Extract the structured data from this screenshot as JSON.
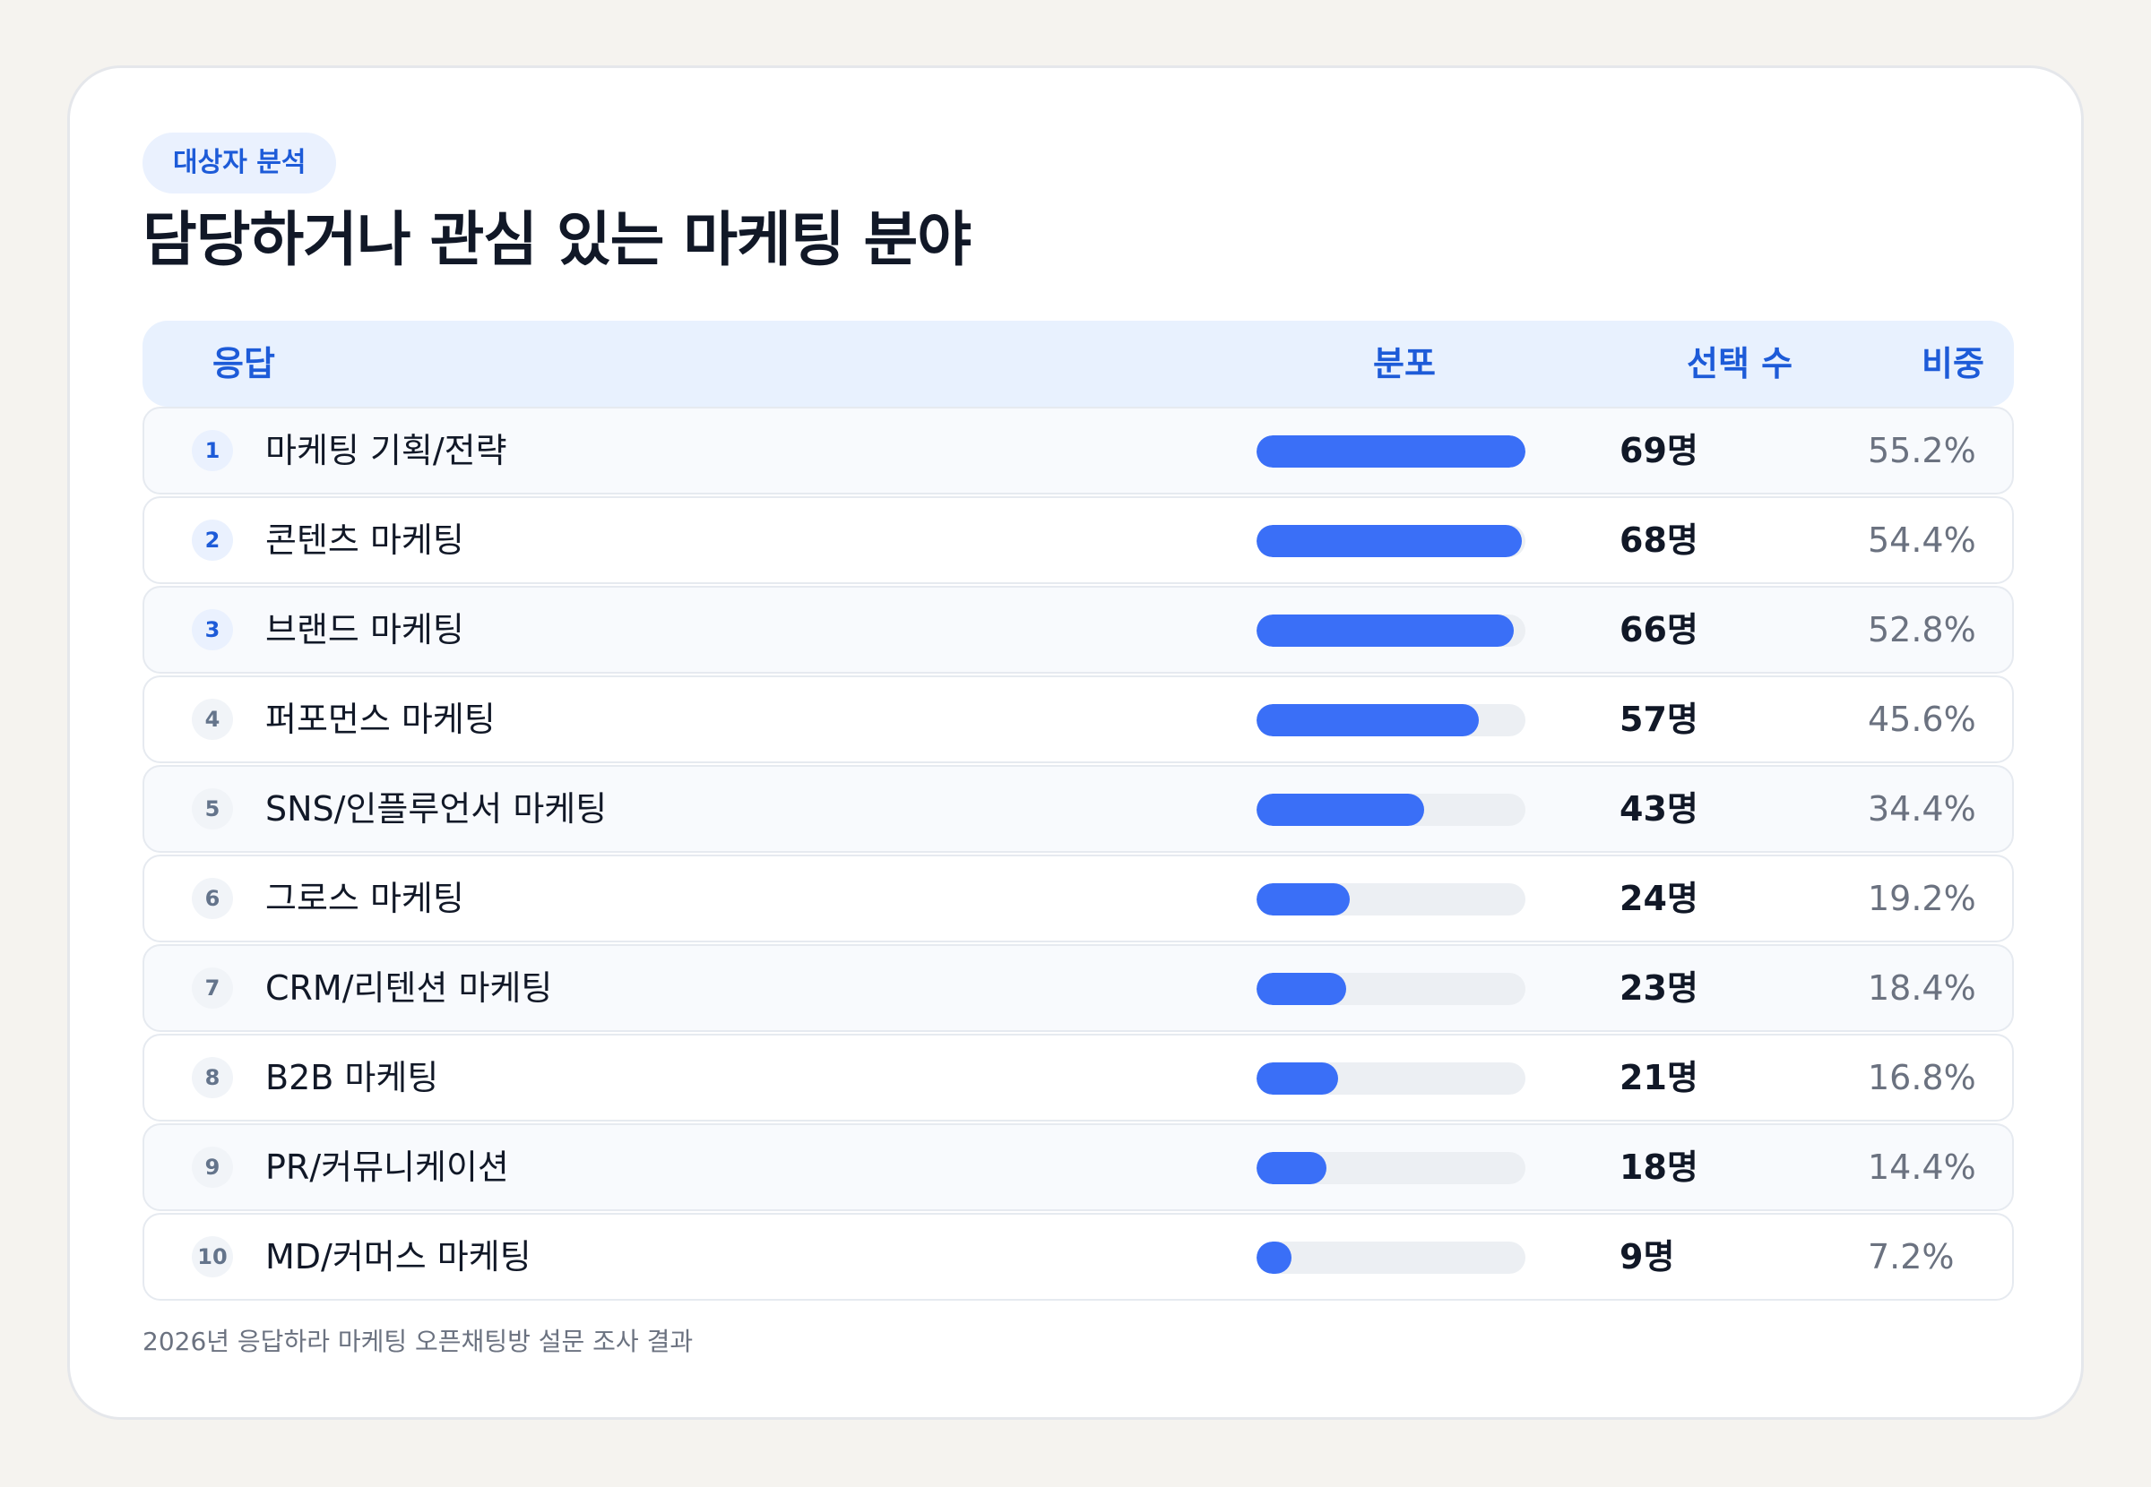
{
  "badge": "대상자 분석",
  "title": "담당하거나 관심 있는 마케팅 분야",
  "header": {
    "response": "응답",
    "distribution": "분포",
    "count": "선택 수",
    "share": "비중"
  },
  "footnote": "2026년 응답하라 마케팅 오픈채팅방 설문 조사 결과",
  "colors": {
    "bar": "#3a6ff7",
    "track": "#eceff3",
    "accent": "#1d5bd8"
  },
  "chart_data": {
    "type": "bar",
    "title": "담당하거나 관심 있는 마케팅 분야",
    "categories": [
      "마케팅 기획/전략",
      "콘텐츠 마케팅",
      "브랜드 마케팅",
      "퍼포먼스 마케팅",
      "SNS/인플루언서 마케팅",
      "그로스 마케팅",
      "CRM/리텐션 마케팅",
      "B2B 마케팅",
      "PR/커뮤니케이션",
      "MD/커머스 마케팅"
    ],
    "values": [
      69,
      68,
      66,
      57,
      43,
      24,
      23,
      21,
      18,
      9
    ],
    "percentages": [
      55.2,
      54.4,
      52.8,
      45.6,
      34.4,
      19.2,
      18.4,
      16.8,
      14.4,
      7.2
    ],
    "xlim": [
      0,
      69
    ],
    "orientation": "horizontal",
    "rows": [
      {
        "rank": "1",
        "label": "마케팅 기획/전략",
        "count": "69명",
        "pct": "55.2%",
        "value": 69
      },
      {
        "rank": "2",
        "label": "콘텐츠 마케팅",
        "count": "68명",
        "pct": "54.4%",
        "value": 68
      },
      {
        "rank": "3",
        "label": "브랜드 마케팅",
        "count": "66명",
        "pct": "52.8%",
        "value": 66
      },
      {
        "rank": "4",
        "label": "퍼포먼스 마케팅",
        "count": "57명",
        "pct": "45.6%",
        "value": 57
      },
      {
        "rank": "5",
        "label": "SNS/인플루언서 마케팅",
        "count": "43명",
        "pct": "34.4%",
        "value": 43
      },
      {
        "rank": "6",
        "label": "그로스 마케팅",
        "count": "24명",
        "pct": "19.2%",
        "value": 24
      },
      {
        "rank": "7",
        "label": "CRM/리텐션 마케팅",
        "count": "23명",
        "pct": "18.4%",
        "value": 23
      },
      {
        "rank": "8",
        "label": "B2B 마케팅",
        "count": "21명",
        "pct": "16.8%",
        "value": 21
      },
      {
        "rank": "9",
        "label": "PR/커뮤니케이션",
        "count": "18명",
        "pct": "14.4%",
        "value": 18
      },
      {
        "rank": "10",
        "label": "MD/커머스 마케팅",
        "count": "9명",
        "pct": "7.2%",
        "value": 9
      }
    ]
  }
}
